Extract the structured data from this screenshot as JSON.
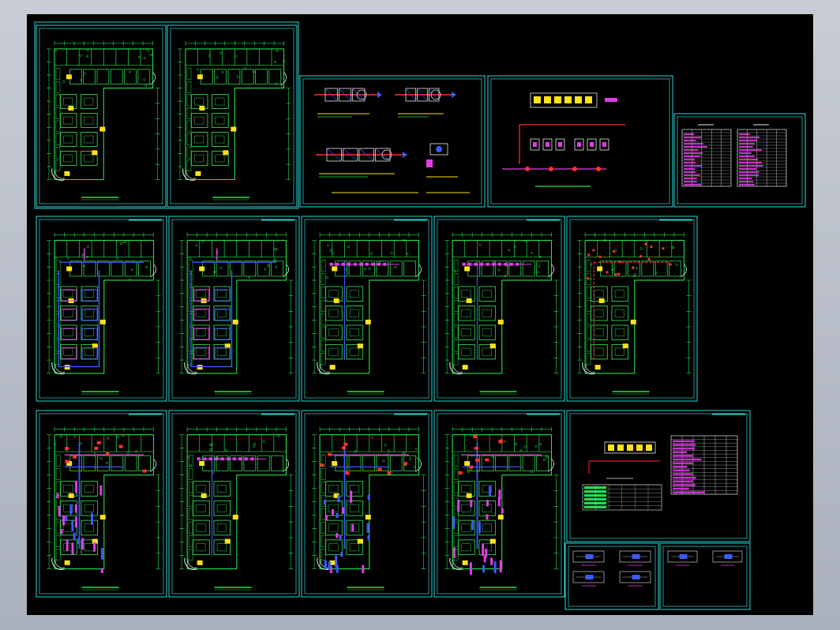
{
  "viewer": {
    "background": "#000000",
    "colors": {
      "frame": "#2ad6d6",
      "walls": "#22e04a",
      "rooms": "#2fd24f",
      "ducts_magenta": "#e13ce6",
      "ducts_blue": "#3c5bff",
      "accent_yellow": "#ffe21a",
      "red": "#ff3030",
      "white": "#e6e6e6"
    }
  },
  "sheets": {
    "floor_plans_top": [
      {
        "id": "plan-1",
        "kind": "floor-plan",
        "variant": "architectural"
      },
      {
        "id": "plan-2",
        "kind": "floor-plan",
        "variant": "architectural"
      }
    ],
    "schematics": [
      {
        "id": "ahu-diagrams",
        "kind": "equipment-diagrams"
      },
      {
        "id": "system-diagram",
        "kind": "riser-diagram"
      },
      {
        "id": "schedule-tables",
        "kind": "tables"
      }
    ],
    "floor_plans_middle": [
      {
        "id": "plan-3",
        "kind": "floor-plan",
        "variant": "hvac-blue"
      },
      {
        "id": "plan-4",
        "kind": "floor-plan",
        "variant": "hvac-blue"
      },
      {
        "id": "plan-5",
        "kind": "floor-plan",
        "variant": "hvac-light"
      },
      {
        "id": "plan-6",
        "kind": "floor-plan",
        "variant": "hvac-light"
      },
      {
        "id": "plan-7",
        "kind": "floor-plan",
        "variant": "hvac-red"
      }
    ],
    "floor_plans_bottom": [
      {
        "id": "plan-8",
        "kind": "floor-plan",
        "variant": "hvac-dense"
      },
      {
        "id": "plan-9",
        "kind": "floor-plan",
        "variant": "hvac-light"
      },
      {
        "id": "plan-10",
        "kind": "floor-plan",
        "variant": "hvac-dense"
      },
      {
        "id": "plan-11",
        "kind": "floor-plan",
        "variant": "hvac-dense"
      }
    ],
    "details": [
      {
        "id": "legend-sheet",
        "kind": "legend-and-tables"
      },
      {
        "id": "detail-sections-1",
        "kind": "sections"
      },
      {
        "id": "detail-sections-2",
        "kind": "sections"
      }
    ]
  }
}
